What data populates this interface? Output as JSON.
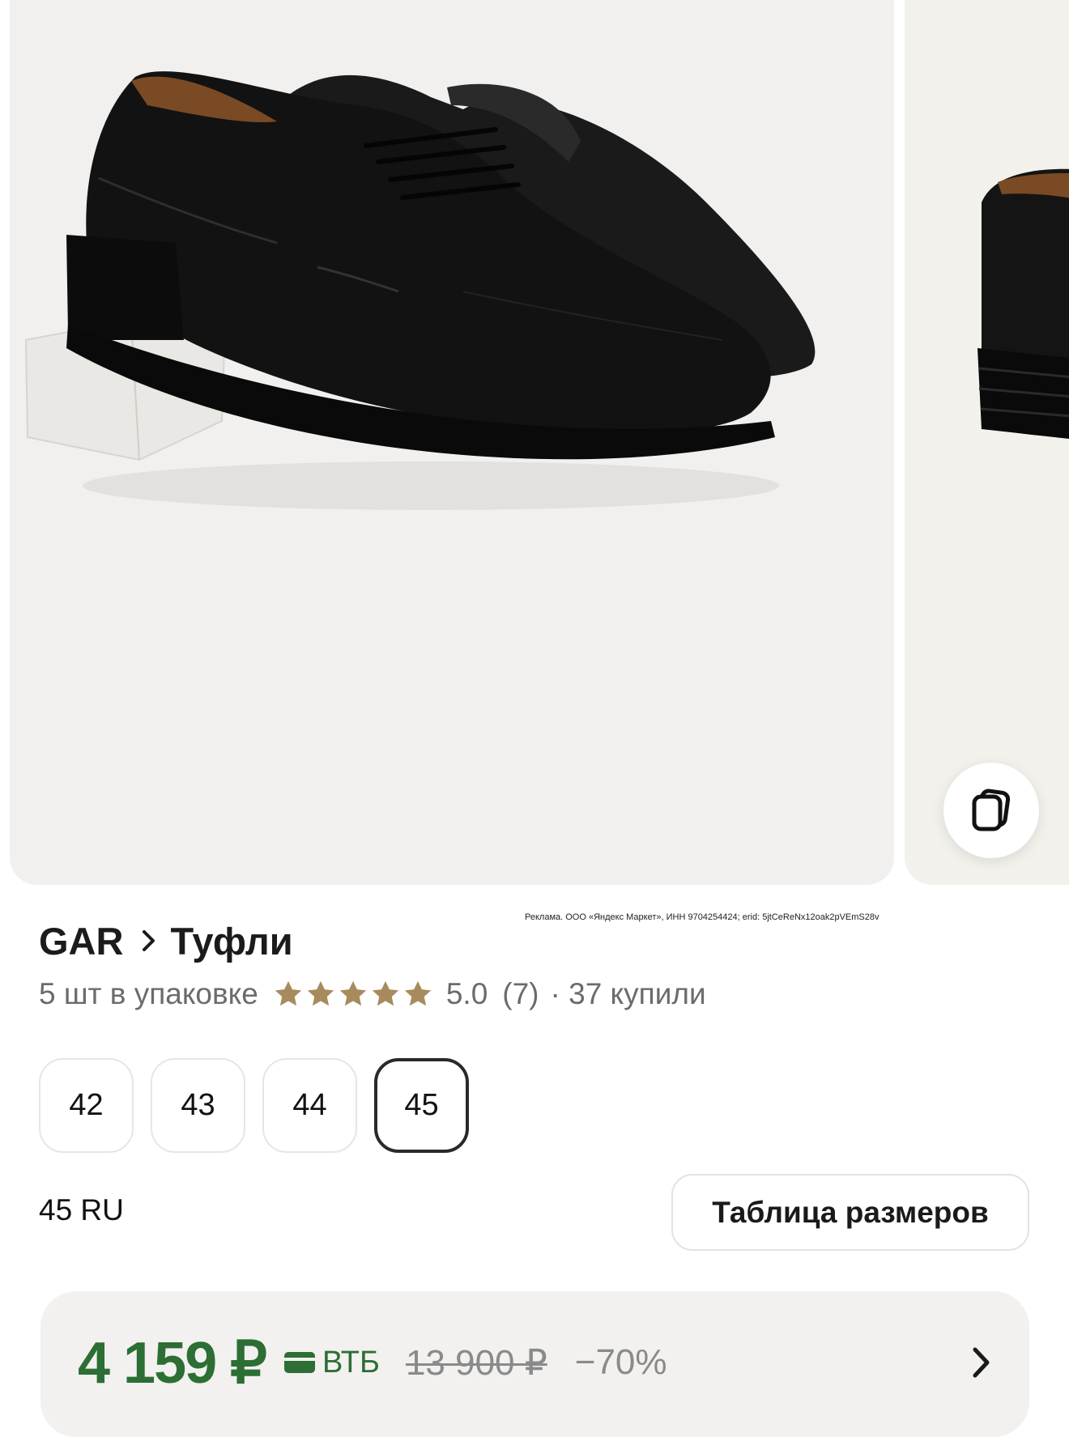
{
  "ad_note": "Реклама. ООО «Яндекс Маркет», ИНН 9704254424; erid: 5jtCeReNx12oak2pVEmS28v",
  "breadcrumb": {
    "brand": "GAR",
    "category": "Туфли"
  },
  "product": {
    "pack": "5 шт в упаковке",
    "rating": "5.0",
    "reviews": "(7)",
    "bought": "· 37 купили",
    "stars": 5
  },
  "sizes": {
    "options": [
      "42",
      "43",
      "44",
      "45"
    ],
    "selected": "45",
    "selected_label": "45 RU",
    "table_button": "Таблица размеров"
  },
  "price": {
    "current": "4 159 ₽",
    "bank": "ВТБ",
    "old": "13 900 ₽",
    "discount": "−70%"
  },
  "colors": {
    "price_green": "#2c6e34",
    "star_gold": "#a88b5c",
    "muted_text": "#6b6b6b"
  },
  "icons": {
    "gallery": "gallery-icon",
    "chevron": "chevron-right-icon",
    "star": "star-icon",
    "card": "card-icon"
  }
}
